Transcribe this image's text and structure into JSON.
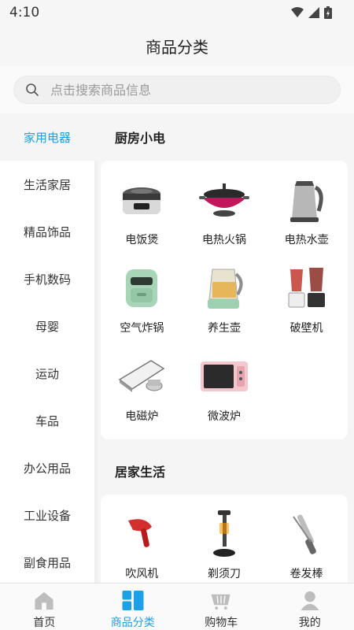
{
  "status": {
    "time": "4:10"
  },
  "header": {
    "title": "商品分类"
  },
  "search": {
    "placeholder": "点击搜索商品信息"
  },
  "sidebar": {
    "items": [
      {
        "label": "家用电器",
        "active": true
      },
      {
        "label": "生活家居"
      },
      {
        "label": "精品饰品"
      },
      {
        "label": "手机数码"
      },
      {
        "label": "母婴"
      },
      {
        "label": "运动"
      },
      {
        "label": "车品"
      },
      {
        "label": "办公用品"
      },
      {
        "label": "工业设备"
      },
      {
        "label": "副食用品"
      }
    ]
  },
  "sections": [
    {
      "title": "厨房小电",
      "products": [
        {
          "label": "电饭煲",
          "icon": "rice-cooker-icon"
        },
        {
          "label": "电热火锅",
          "icon": "hotpot-icon"
        },
        {
          "label": "电热水壶",
          "icon": "kettle-icon"
        },
        {
          "label": "空气炸锅",
          "icon": "air-fryer-icon"
        },
        {
          "label": "养生壶",
          "icon": "health-pot-icon"
        },
        {
          "label": "破壁机",
          "icon": "blender-icon"
        },
        {
          "label": "电磁炉",
          "icon": "induction-cooker-icon"
        },
        {
          "label": "微波炉",
          "icon": "microwave-icon"
        }
      ]
    },
    {
      "title": "居家生活",
      "products": [
        {
          "label": "吹风机",
          "icon": "hair-dryer-icon"
        },
        {
          "label": "剃须刀",
          "icon": "razor-icon"
        },
        {
          "label": "卷发棒",
          "icon": "curling-iron-icon"
        }
      ]
    }
  ],
  "nav": {
    "items": [
      {
        "label": "首页",
        "icon": "home-icon"
      },
      {
        "label": "商品分类",
        "icon": "category-icon",
        "active": true
      },
      {
        "label": "购物车",
        "icon": "cart-icon"
      },
      {
        "label": "我的",
        "icon": "profile-icon"
      }
    ]
  },
  "colors": {
    "accent": "#1ea0e6",
    "background": "#f5f5f5",
    "card": "#ffffff"
  }
}
